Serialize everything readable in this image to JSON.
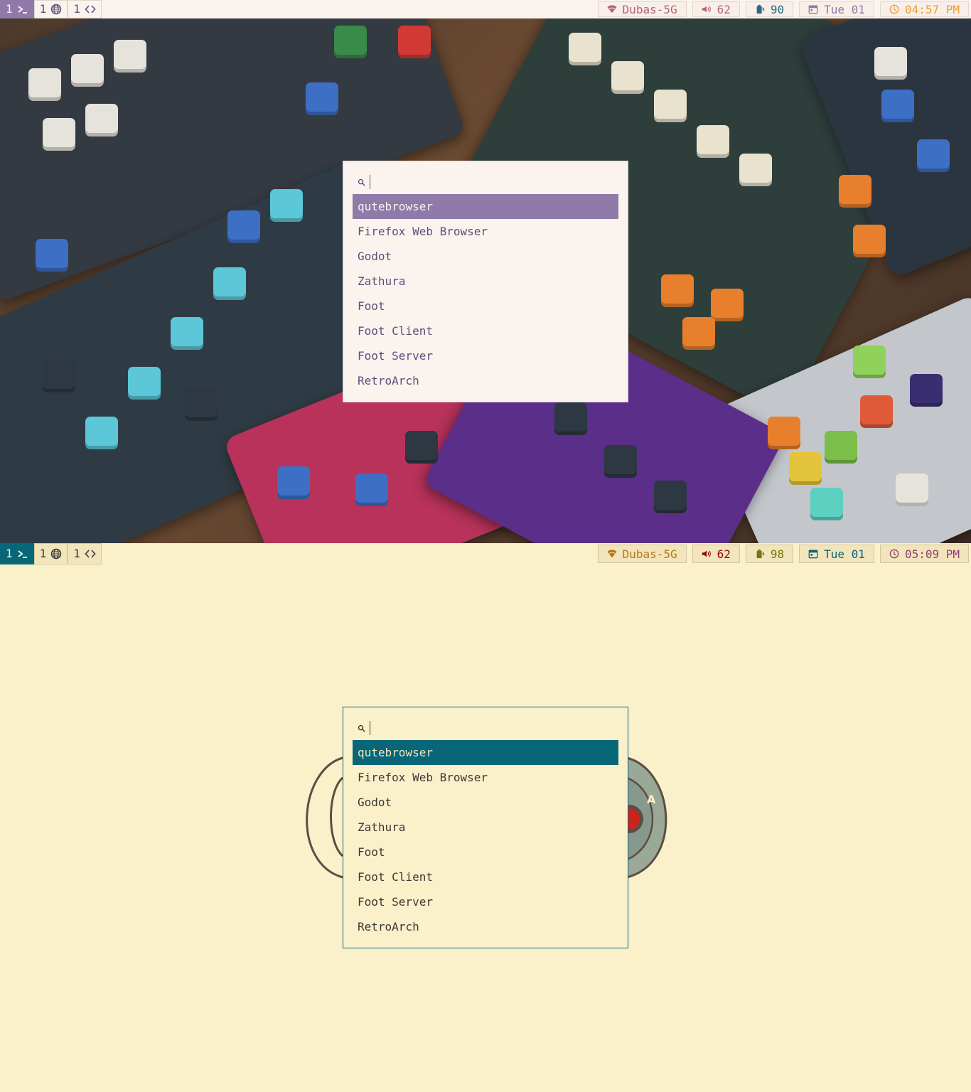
{
  "colors": {
    "top": {
      "accent": "#907aa9",
      "wifi": "#b4637a",
      "volume": "#b4637a",
      "battery": "#286983",
      "date": "#907aa9",
      "clock": "#ea9d34"
    },
    "bottom": {
      "accent": "#076678",
      "wifi": "#b57614",
      "volume": "#9d0006",
      "battery": "#79740e",
      "date": "#076678",
      "clock": "#8f3f71"
    }
  },
  "top": {
    "bar": {
      "workspaces": [
        {
          "num": "1",
          "icon": "terminal-icon"
        },
        {
          "num": "1",
          "icon": "globe-icon"
        },
        {
          "num": "1",
          "icon": "code-icon"
        }
      ],
      "wifi": "Dubas-5G",
      "volume": "62",
      "battery": "90",
      "date": "Tue 01",
      "clock": "04:57 PM"
    },
    "launcher": {
      "items": [
        "qutebrowser",
        "Firefox Web Browser",
        "Godot",
        "Zathura",
        "Foot",
        "Foot Client",
        "Foot Server",
        "RetroArch"
      ]
    }
  },
  "bottom": {
    "bar": {
      "workspaces": [
        {
          "num": "1",
          "icon": "terminal-icon"
        },
        {
          "num": "1",
          "icon": "globe-icon"
        },
        {
          "num": "1",
          "icon": "code-icon"
        }
      ],
      "wifi": "Dubas-5G",
      "volume": "62",
      "battery": "98",
      "date": "Tue 01",
      "clock": "05:09 PM"
    },
    "launcher": {
      "items": [
        "qutebrowser",
        "Firefox Web Browser",
        "Godot",
        "Zathura",
        "Foot",
        "Foot Client",
        "Foot Server",
        "RetroArch"
      ]
    },
    "decoration_letter": "A"
  }
}
